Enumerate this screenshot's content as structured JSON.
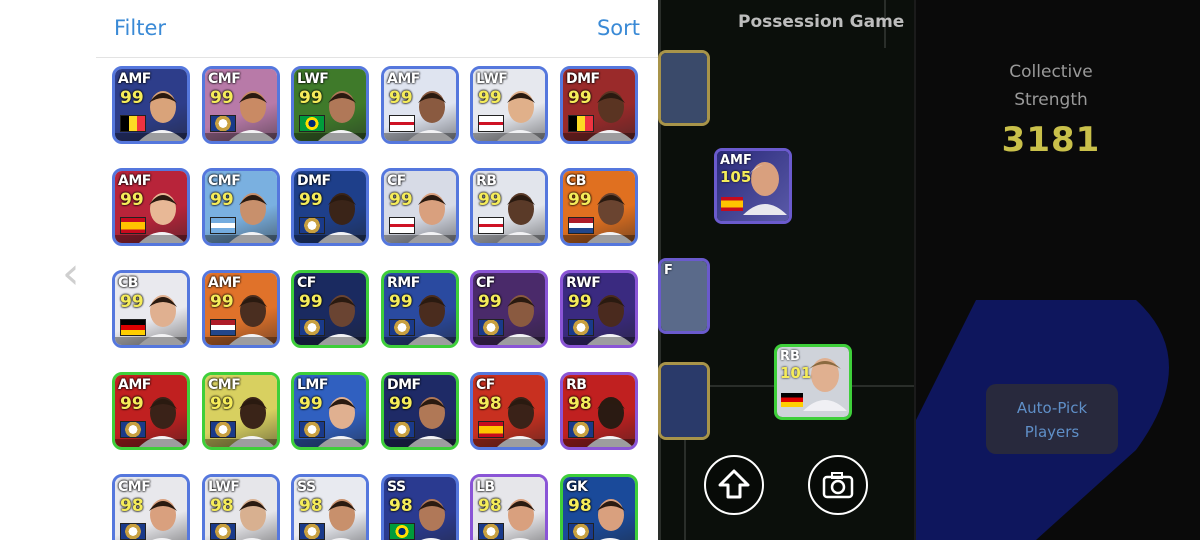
{
  "panel": {
    "filter_label": "Filter",
    "sort_label": "Sort"
  },
  "cards": [
    {
      "pos": "AMF",
      "rating": "99",
      "border": "blue",
      "bg": "#2d3d8a",
      "face": "#d9a37a",
      "flag": "belgium"
    },
    {
      "pos": "CMF",
      "rating": "99",
      "border": "blue",
      "bg": "#b87aa8",
      "face": "#c98a64",
      "flag": "club"
    },
    {
      "pos": "LWF",
      "rating": "99",
      "border": "blue",
      "bg": "#3f7a2a",
      "face": "#b07858",
      "flag": "brazil"
    },
    {
      "pos": "AMF",
      "rating": "99",
      "border": "blue",
      "bg": "#dfe4f0",
      "face": "#8a5a40",
      "flag": "england"
    },
    {
      "pos": "LWF",
      "rating": "99",
      "border": "blue",
      "bg": "#e6e8ee",
      "face": "#e0b08a",
      "flag": "england"
    },
    {
      "pos": "DMF",
      "rating": "99",
      "border": "blue",
      "bg": "#9a2a2a",
      "face": "#5a3422",
      "flag": "belgium"
    },
    {
      "pos": "AMF",
      "rating": "99",
      "border": "blue",
      "bg": "#b8243a",
      "face": "#e8b896",
      "flag": "spain"
    },
    {
      "pos": "CMF",
      "rating": "99",
      "border": "blue",
      "bg": "#7ab0e0",
      "face": "#c8906c",
      "flag": "argentina"
    },
    {
      "pos": "DMF",
      "rating": "99",
      "border": "blue",
      "bg": "#1e3f8a",
      "face": "#3a2418",
      "flag": "club"
    },
    {
      "pos": "CF",
      "rating": "99",
      "border": "blue",
      "bg": "#d7dbe6",
      "face": "#d9a07e",
      "flag": "england"
    },
    {
      "pos": "RB",
      "rating": "99",
      "border": "blue",
      "bg": "#e2e5ec",
      "face": "#5a3a28",
      "flag": "england"
    },
    {
      "pos": "CB",
      "rating": "99",
      "border": "blue",
      "bg": "#e07020",
      "face": "#6a4430",
      "flag": "netherlands"
    },
    {
      "pos": "CB",
      "rating": "99",
      "border": "blue",
      "bg": "#e9e9ee",
      "face": "#e0b090",
      "flag": "germany"
    },
    {
      "pos": "AMF",
      "rating": "99",
      "border": "blue",
      "bg": "#e0722a",
      "face": "#4a2e20",
      "flag": "netherlands"
    },
    {
      "pos": "CF",
      "rating": "99",
      "border": "green",
      "bg": "#1a2a60",
      "face": "#6a4432",
      "flag": "club"
    },
    {
      "pos": "RMF",
      "rating": "99",
      "border": "green",
      "bg": "#2a4aa0",
      "face": "#4a2c1e",
      "flag": "club"
    },
    {
      "pos": "CF",
      "rating": "99",
      "border": "purple",
      "bg": "#4a2a6a",
      "face": "#8a5a40",
      "flag": "club"
    },
    {
      "pos": "RWF",
      "rating": "99",
      "border": "purple",
      "bg": "#3a2a80",
      "face": "#4a2a1e",
      "flag": "club"
    },
    {
      "pos": "AMF",
      "rating": "99",
      "border": "green",
      "bg": "#c02020",
      "face": "#3a2218",
      "flag": "club"
    },
    {
      "pos": "CMF",
      "rating": "99",
      "border": "green",
      "bg": "#d8d060",
      "face": "#3a2418",
      "flag": "club"
    },
    {
      "pos": "LMF",
      "rating": "99",
      "border": "green",
      "bg": "#3060c0",
      "face": "#e0b090",
      "flag": "club"
    },
    {
      "pos": "DMF",
      "rating": "99",
      "border": "green",
      "bg": "#1e2a66",
      "face": "#b07856",
      "flag": "club"
    },
    {
      "pos": "CF",
      "rating": "98",
      "border": "blue",
      "bg": "#c83020",
      "face": "#3a2218",
      "flag": "spain"
    },
    {
      "pos": "RB",
      "rating": "98",
      "border": "purple",
      "bg": "#c02020",
      "face": "#2a1a12",
      "flag": "club"
    },
    {
      "pos": "CMF",
      "rating": "98",
      "border": "blue",
      "bg": "#e8e8ec",
      "face": "#d9a07e",
      "flag": "club"
    },
    {
      "pos": "LWF",
      "rating": "98",
      "border": "blue",
      "bg": "#e6e6ea",
      "face": "#d8b090",
      "flag": "club"
    },
    {
      "pos": "SS",
      "rating": "98",
      "border": "blue",
      "bg": "#e8eaf0",
      "face": "#c8906c",
      "flag": "club"
    },
    {
      "pos": "SS",
      "rating": "98",
      "border": "blue",
      "bg": "#2a3a90",
      "face": "#b07858",
      "flag": "brazil"
    },
    {
      "pos": "LB",
      "rating": "98",
      "border": "purple",
      "bg": "#e6e6ea",
      "face": "#d9a07e",
      "flag": "club"
    },
    {
      "pos": "GK",
      "rating": "98",
      "border": "green",
      "bg": "#1a4a9a",
      "face": "#d9a07e",
      "flag": "club"
    }
  ],
  "field": {
    "mode_title": "Possession Game",
    "mini_cards": [
      {
        "pos": "",
        "rating": "",
        "border": "gold",
        "bg": "#3a4a6a"
      },
      {
        "pos": "AMF",
        "rating": "105",
        "border": "purple",
        "bg": "#3a3a8a"
      },
      {
        "pos": "F",
        "rating": "",
        "border": "purple",
        "bg": "#5a6a8a"
      },
      {
        "pos": "RB",
        "rating": "101",
        "border": "green",
        "bg": "#cfd3da"
      },
      {
        "pos": "",
        "rating": "",
        "border": "gold",
        "bg": "#2a3a6a"
      }
    ],
    "upload_icon": "arrow-up-icon",
    "camera_icon": "camera-icon"
  },
  "side": {
    "strength_label_line1": "Collective",
    "strength_label_line2": "Strength",
    "strength_value": "3181",
    "autopick_line1": "Auto-Pick",
    "autopick_line2": "Players"
  },
  "colors": {
    "accent_blue": "#3a8ad6",
    "rating_yellow": "#f5ec5a",
    "strength_gold": "#c9c04a"
  }
}
